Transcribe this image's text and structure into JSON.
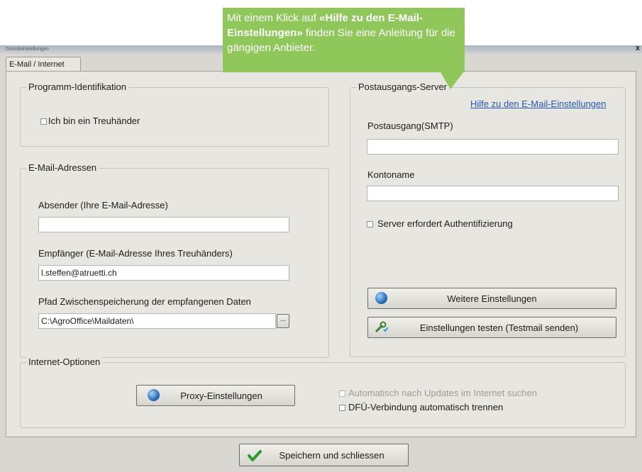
{
  "window": {
    "title": "Grundeinstellungen"
  },
  "tabs": [
    {
      "label": "E-Mail / Internet"
    }
  ],
  "callout": {
    "prefix": "Mit einem Klick auf ",
    "quote_open": "«",
    "bold": "Hilfe zu den E-Mail-Einstellungen",
    "quote_close": "»",
    "suffix": " finden Sie eine Anleitung für die gängigen Anbieter.",
    "color": "#8fc75a"
  },
  "program": {
    "title": "Programm-Identifikation",
    "treuhaender_label": "Ich bin ein Treuhänder",
    "treuhaender_checked": false
  },
  "email": {
    "title": "E-Mail-Adressen",
    "sender_label": "Absender (Ihre E-Mail-Adresse)",
    "sender_value": "",
    "recipient_label": "Empfänger  (E-Mail-Adresse Ihres Treuhänders)",
    "recipient_value": "l.steffen@atruetti.ch",
    "path_label": "Pfad Zwischenspeicherung der empfangenen Daten",
    "path_value": "C:\\AgroOffice\\Maildaten\\",
    "browse_label": "..."
  },
  "server": {
    "title": "Postausgangs-Server",
    "help_link": "Hilfe zu den E-Mail-Einstellungen",
    "smtp_label": "Postausgang(SMTP)",
    "smtp_value": "",
    "account_label": "Kontoname",
    "account_value": "",
    "auth_label": "Server erfordert Authentifizierung",
    "auth_checked": false,
    "more_settings_button": "Weitere Einstellungen",
    "test_button": "Einstellungen testen (Testmail senden)"
  },
  "internet": {
    "title": "Internet-Optionen",
    "proxy_button": "Proxy-Einstellungen",
    "auto_update_label": "Automatisch nach Updates im Internet suchen",
    "auto_update_enabled": false,
    "dfue_label": "DFÜ-Verbindung automatisch trennen",
    "dfue_checked": false
  },
  "footer": {
    "save_button": "Speichern und schliessen"
  },
  "icons": [
    "globe-icon",
    "wrench-check-icon",
    "checkmark-icon",
    "close-icon"
  ]
}
